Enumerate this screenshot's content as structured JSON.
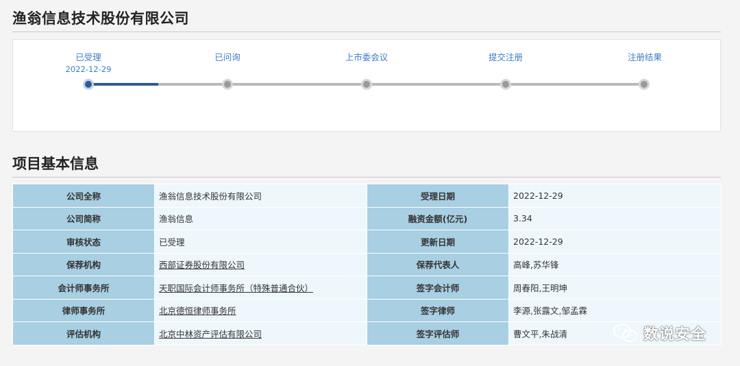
{
  "header": {
    "company_title": "渔翁信息技术股份有限公司"
  },
  "progress": {
    "steps": [
      {
        "label": "已受理",
        "date": "2022-12-29",
        "active": true
      },
      {
        "label": "已问询",
        "date": ""
      },
      {
        "label": "上市委会议",
        "date": ""
      },
      {
        "label": "提交注册",
        "date": ""
      },
      {
        "label": "注册结果",
        "date": ""
      }
    ],
    "completed_fraction": 0.125,
    "accent_color": "#2d5a9e"
  },
  "section": {
    "title": "项目基本信息"
  },
  "table": {
    "rows": [
      {
        "k1": "公司全称",
        "v1": "渔翁信息技术股份有限公司",
        "k2": "受理日期",
        "v2": "2022-12-29"
      },
      {
        "k1": "公司简称",
        "v1": "渔翁信息",
        "k2": "融资金额(亿元)",
        "v2": "3.34"
      },
      {
        "k1": "审核状态",
        "v1": "已受理",
        "k2": "更新日期",
        "v2": "2022-12-29"
      },
      {
        "k1": "保荐机构",
        "v1": "西部证券股份有限公司",
        "k2": "保荐代表人",
        "v2": "高峰,苏华锋"
      },
      {
        "k1": "会计师事务所",
        "v1": "天职国际会计师事务所（特殊普通合伙）",
        "k2": "签字会计师",
        "v2": "周春阳,王明坤"
      },
      {
        "k1": "律师事务所",
        "v1": "北京德恒律师事务所",
        "k2": "签字律师",
        "v2": "李源,张露文,邹孟霖"
      },
      {
        "k1": "评估机构",
        "v1": "北京中林资产评估有限公司",
        "k2": "签字评估师",
        "v2": "曹文平,朱战清"
      }
    ]
  },
  "watermark": {
    "text": "数说安全",
    "icon": "wechat-icon"
  }
}
